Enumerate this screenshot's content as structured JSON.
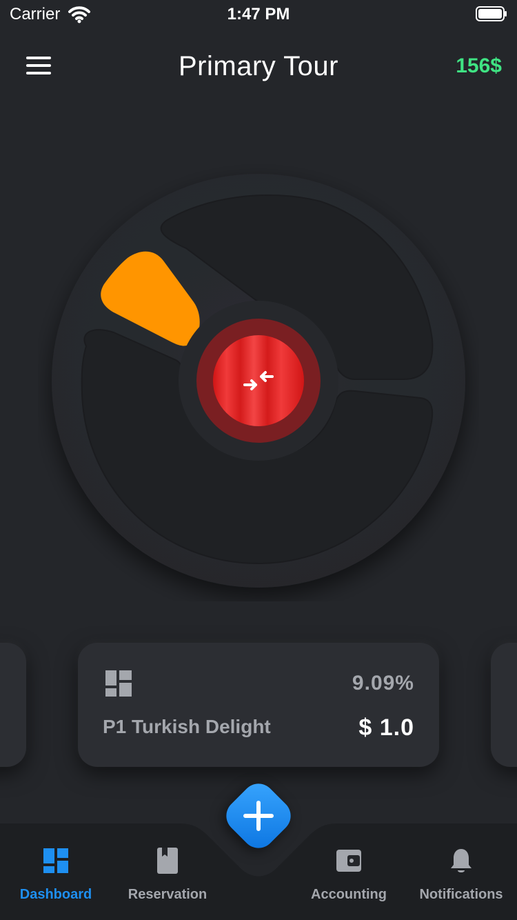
{
  "status_bar": {
    "carrier": "Carrier",
    "time": "1:47 PM"
  },
  "header": {
    "title": "Primary Tour",
    "balance": "156$"
  },
  "product_card": {
    "icon": "dashboard-grid-icon",
    "percent": "9.09%",
    "name": "P1 Turkish Delight",
    "price": "$ 1.0"
  },
  "nav": {
    "items": [
      {
        "label": "Dashboard",
        "icon": "dashboard-icon",
        "active": true
      },
      {
        "label": "Reservation",
        "icon": "book-icon",
        "active": false
      },
      {
        "label": "Accounting",
        "icon": "wallet-icon",
        "active": false
      },
      {
        "label": "Notifications",
        "icon": "bell-icon",
        "active": false
      }
    ]
  },
  "colors": {
    "background": "#24262a",
    "accent_blue": "#1e8ff0",
    "balance_green": "#3fe383",
    "wheel_segment": "#ff9500",
    "center_button": "#e81f1f"
  }
}
